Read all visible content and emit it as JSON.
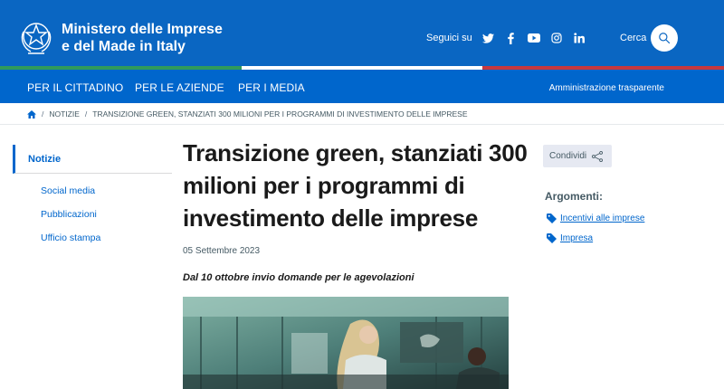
{
  "header": {
    "org_line1": "Ministero delle Imprese",
    "org_line2": "e del Made in Italy",
    "social_label": "Seguici su",
    "social_icons": [
      "twitter-icon",
      "facebook-icon",
      "youtube-icon",
      "instagram-icon",
      "linkedin-icon"
    ],
    "search_label": "Cerca",
    "colors": {
      "primary": "#0a66c2",
      "nav": "#0066cc",
      "green": "#2f9a5b",
      "red": "#c6383f"
    }
  },
  "nav": {
    "items": [
      "PER IL CITTADINO",
      "PER LE AZIENDE",
      "PER I MEDIA"
    ],
    "right": "Amministrazione trasparente"
  },
  "breadcrumb": {
    "home_icon": "home-icon",
    "items": [
      "NOTIZIE",
      "TRANSIZIONE GREEN, STANZIATI 300 MILIONI PER I PROGRAMMI DI INVESTIMENTO DELLE IMPRESE"
    ]
  },
  "sidebar": {
    "active": "Notizie",
    "links": [
      "Social media",
      "Pubblicazioni",
      "Ufficio stampa"
    ]
  },
  "article": {
    "title": "Transizione green, stanziati 300 milioni per i programmi di investimento delle imprese",
    "date": "05 Settembre 2023",
    "subtitle": "Dal 10 ottobre invio domande per le agevolazioni"
  },
  "aside": {
    "share_label": "Condividi",
    "topics_title": "Argomenti:",
    "topics": [
      "Incentivi alle imprese",
      "Impresa"
    ]
  }
}
